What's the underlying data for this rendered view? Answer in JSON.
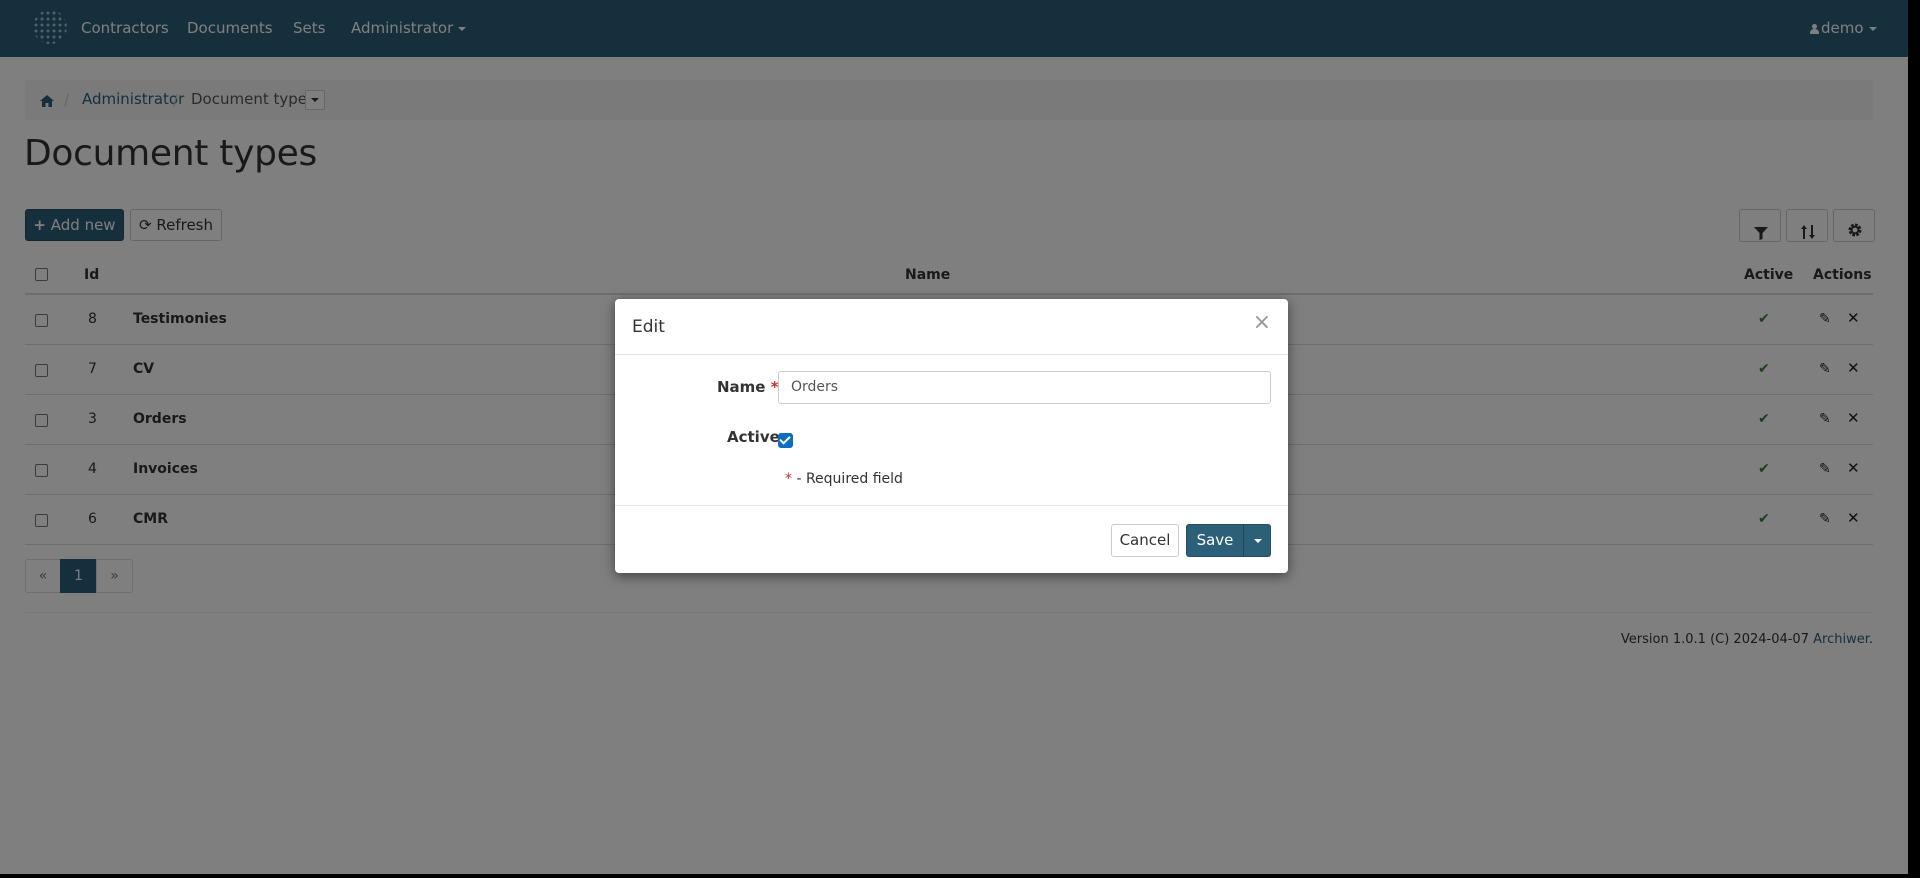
{
  "navbar": {
    "items": [
      "Contractors",
      "Documents",
      "Sets",
      "Administrator"
    ],
    "user": "demo"
  },
  "breadcrumb": {
    "home_icon": "home-icon",
    "items": [
      "Administrator",
      "Document types"
    ]
  },
  "page": {
    "title": "Document types"
  },
  "toolbar": {
    "add_label": "Add new",
    "refresh_label": "Refresh",
    "filter_icon": "filter-icon",
    "sort_icon": "sort-icon",
    "settings_icon": "gear-icon"
  },
  "table": {
    "columns": {
      "id": "Id",
      "name": "Name",
      "active": "Active",
      "actions": "Actions"
    },
    "rows": [
      {
        "id": "8",
        "name": "Testimonies",
        "active": true
      },
      {
        "id": "7",
        "name": "CV",
        "active": true
      },
      {
        "id": "3",
        "name": "Orders",
        "active": true
      },
      {
        "id": "4",
        "name": "Invoices",
        "active": true
      },
      {
        "id": "6",
        "name": "CMR",
        "active": true
      }
    ]
  },
  "pagination": {
    "prev": "«",
    "current": "1",
    "next": "»"
  },
  "footer": {
    "text": "Version 1.0.1 (C) 2024-04-07",
    "link": "Archiwer",
    "suffix": "."
  },
  "modal": {
    "title": "Edit",
    "close": "×",
    "name_label": "Name",
    "name_value": "Orders",
    "active_label": "Active",
    "active_checked": true,
    "required_mark": "*",
    "required_note": "- Required field",
    "cancel_label": "Cancel",
    "save_label": "Save"
  },
  "colors": {
    "navbar": "#2c5f78",
    "primary": "#2c5f78",
    "success": "#3c763d",
    "required": "#c9302c"
  }
}
